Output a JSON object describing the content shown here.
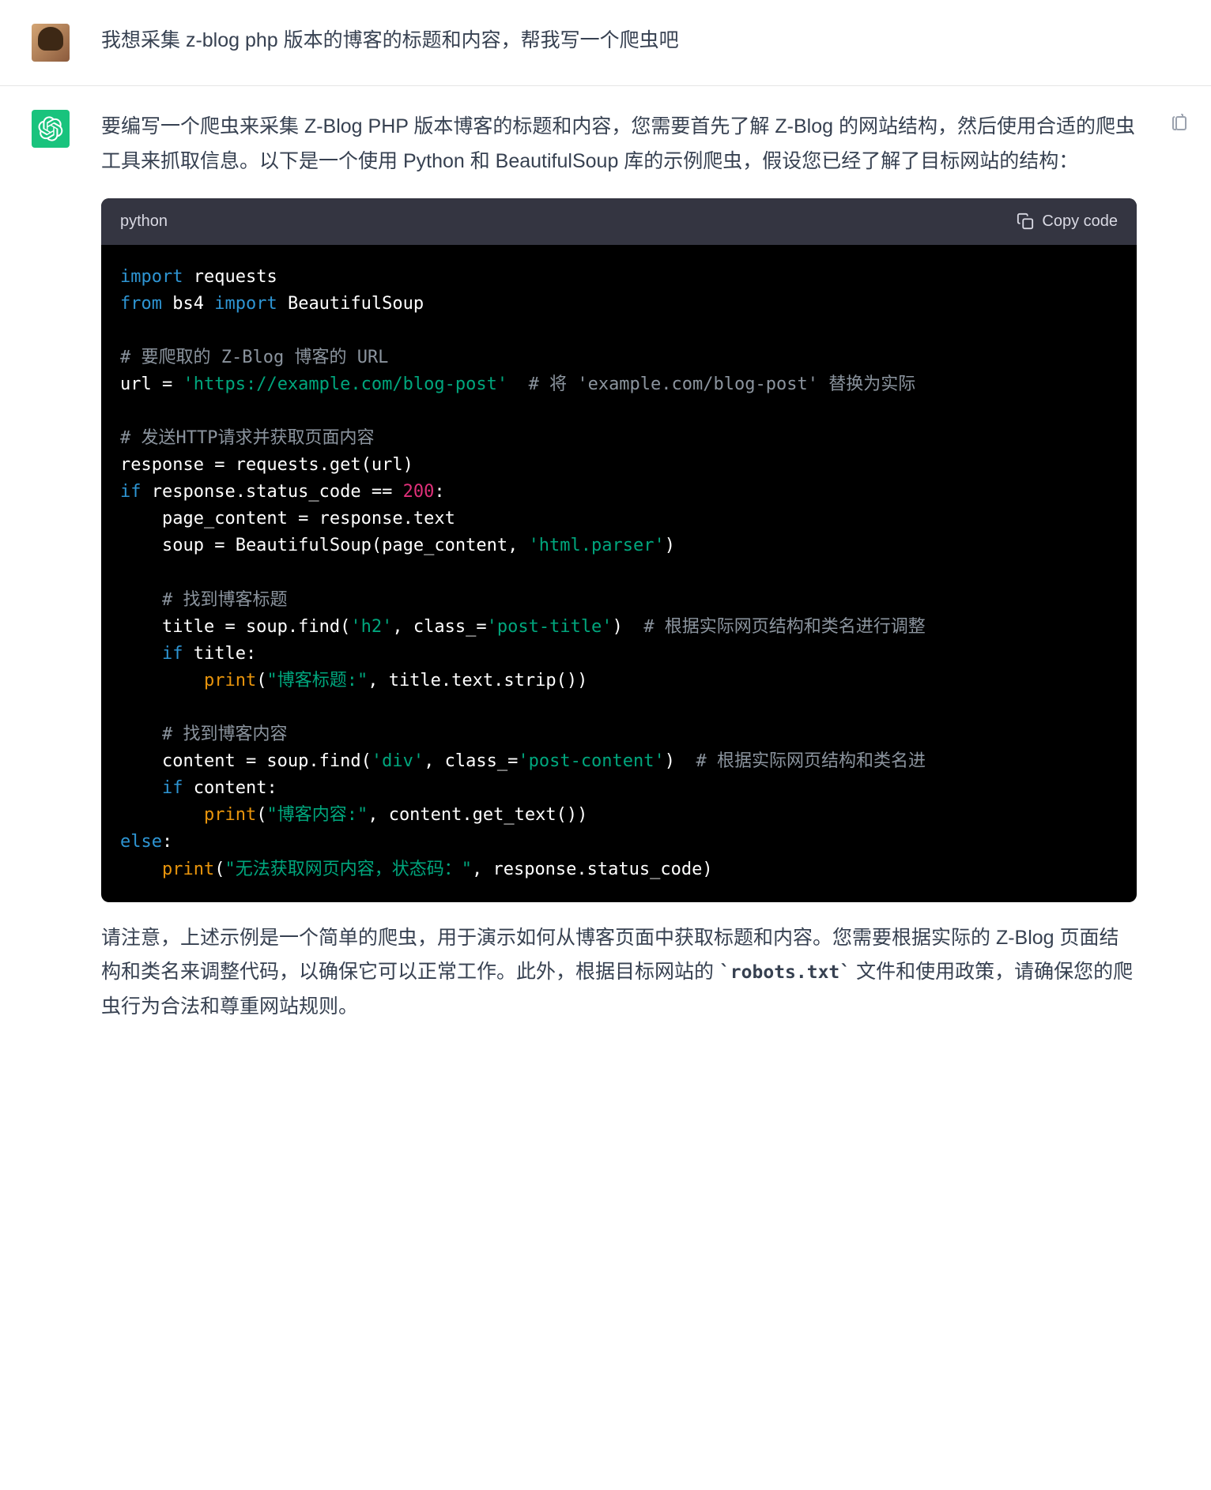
{
  "user_message": "我想采集 z-blog php 版本的博客的标题和内容，帮我写一个爬虫吧",
  "assistant_intro": "要编写一个爬虫来采集 Z-Blog PHP 版本博客的标题和内容，您需要首先了解 Z-Blog 的网站结构，然后使用合适的爬虫工具来抓取信息。以下是一个使用 Python 和 BeautifulSoup 库的示例爬虫，假设您已经了解了目标网站的结构：",
  "assistant_outro_p1": "请注意，上述示例是一个简单的爬虫，用于演示如何从博客页面中获取标题和内容。您需要根据实际的 Z-Blog 页面结构和类名来调整代码，以确保它可以正常工作。此外，根据目标网站的 ",
  "assistant_outro_code": "`robots.txt`",
  "assistant_outro_p2": " 文件和使用政策，请确保您的爬虫行为合法和尊重网站规则。",
  "code_language": "python",
  "copy_code_label": "Copy code",
  "code_tokens": [
    {
      "c": "hl-blue",
      "t": "import"
    },
    {
      "c": "hl-white",
      "t": " requests\n"
    },
    {
      "c": "hl-blue",
      "t": "from"
    },
    {
      "c": "hl-white",
      "t": " bs4 "
    },
    {
      "c": "hl-blue",
      "t": "import"
    },
    {
      "c": "hl-white",
      "t": " BeautifulSoup\n\n"
    },
    {
      "c": "hl-gray",
      "t": "# 要爬取的 Z-Blog 博客的 URL\n"
    },
    {
      "c": "hl-white",
      "t": "url = "
    },
    {
      "c": "hl-green",
      "t": "'https://example.com/blog-post'"
    },
    {
      "c": "hl-white",
      "t": "  "
    },
    {
      "c": "hl-gray",
      "t": "# 将 'example.com/blog-post' 替换为实际\n"
    },
    {
      "c": "hl-white",
      "t": "\n"
    },
    {
      "c": "hl-gray",
      "t": "# 发送HTTP请求并获取页面内容\n"
    },
    {
      "c": "hl-white",
      "t": "response = requests.get(url)\n"
    },
    {
      "c": "hl-blue",
      "t": "if"
    },
    {
      "c": "hl-white",
      "t": " response.status_code == "
    },
    {
      "c": "hl-red",
      "t": "200"
    },
    {
      "c": "hl-white",
      "t": ":\n    page_content = response.text\n    soup = BeautifulSoup(page_content, "
    },
    {
      "c": "hl-green",
      "t": "'html.parser'"
    },
    {
      "c": "hl-white",
      "t": ")\n\n    "
    },
    {
      "c": "hl-gray",
      "t": "# 找到博客标题\n"
    },
    {
      "c": "hl-white",
      "t": "    title = soup.find("
    },
    {
      "c": "hl-green",
      "t": "'h2'"
    },
    {
      "c": "hl-white",
      "t": ", class_="
    },
    {
      "c": "hl-green",
      "t": "'post-title'"
    },
    {
      "c": "hl-white",
      "t": ")  "
    },
    {
      "c": "hl-gray",
      "t": "# 根据实际网页结构和类名进行调整\n"
    },
    {
      "c": "hl-white",
      "t": "    "
    },
    {
      "c": "hl-blue",
      "t": "if"
    },
    {
      "c": "hl-white",
      "t": " title:\n        "
    },
    {
      "c": "hl-yellow",
      "t": "print"
    },
    {
      "c": "hl-white",
      "t": "("
    },
    {
      "c": "hl-green",
      "t": "\"博客标题:\""
    },
    {
      "c": "hl-white",
      "t": ", title.text.strip())\n\n    "
    },
    {
      "c": "hl-gray",
      "t": "# 找到博客内容\n"
    },
    {
      "c": "hl-white",
      "t": "    content = soup.find("
    },
    {
      "c": "hl-green",
      "t": "'div'"
    },
    {
      "c": "hl-white",
      "t": ", class_="
    },
    {
      "c": "hl-green",
      "t": "'post-content'"
    },
    {
      "c": "hl-white",
      "t": ")  "
    },
    {
      "c": "hl-gray",
      "t": "# 根据实际网页结构和类名进\n"
    },
    {
      "c": "hl-white",
      "t": "    "
    },
    {
      "c": "hl-blue",
      "t": "if"
    },
    {
      "c": "hl-white",
      "t": " content:\n        "
    },
    {
      "c": "hl-yellow",
      "t": "print"
    },
    {
      "c": "hl-white",
      "t": "("
    },
    {
      "c": "hl-green",
      "t": "\"博客内容:\""
    },
    {
      "c": "hl-white",
      "t": ", content.get_text())\n"
    },
    {
      "c": "hl-blue",
      "t": "else"
    },
    {
      "c": "hl-white",
      "t": ":\n    "
    },
    {
      "c": "hl-yellow",
      "t": "print"
    },
    {
      "c": "hl-white",
      "t": "("
    },
    {
      "c": "hl-green",
      "t": "\"无法获取网页内容，状态码：\""
    },
    {
      "c": "hl-white",
      "t": ", response.status_code)"
    }
  ]
}
